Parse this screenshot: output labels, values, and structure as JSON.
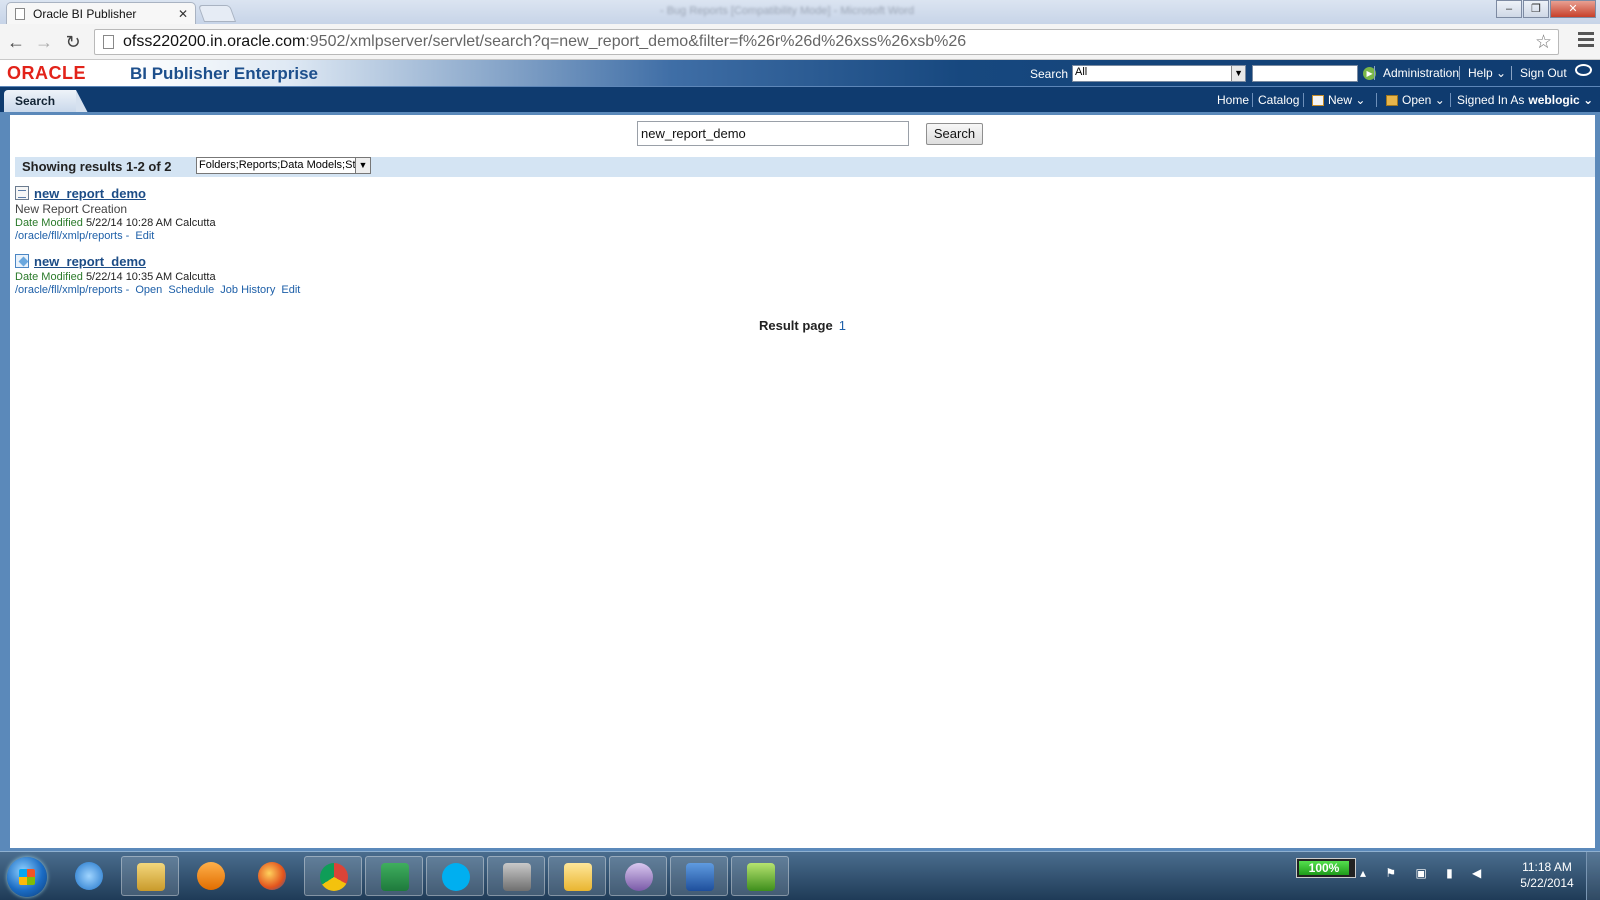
{
  "browser": {
    "tab_title": "Oracle BI Publisher",
    "tab_close": "✕",
    "window_title": "- Bug Reports [Compatibility Mode] - Microsoft Word",
    "url_host": "ofss220200.in.oracle.com",
    "url_path": ":9502/xmlpserver/servlet/search?q=new_report_demo&filter=f%26r%26d%26xss%26xsb%26",
    "window_controls": [
      "–",
      "❐",
      "✕"
    ]
  },
  "header": {
    "logo": "ORACLE",
    "product": "BI Publisher Enterprise",
    "search_label": "Search",
    "search_scope": "All",
    "administration": "Administration",
    "help": "Help ⌄",
    "sign_out": "Sign Out"
  },
  "tabbar": {
    "active_tab": "Search",
    "home": "Home",
    "catalog": "Catalog",
    "new": "New ⌄",
    "open": "Open ⌄",
    "signed_in_as": "Signed In As",
    "username": "weblogic ⌄"
  },
  "search": {
    "query": "new_report_demo",
    "button": "Search",
    "summary": "Showing results 1-2 of 2",
    "filter": "Folders;Reports;Data Models;Style Templates;Sub Templates"
  },
  "results": [
    {
      "title": "new_report_demo",
      "description": "New Report Creation",
      "date_label": "Date Modified",
      "date": "5/22/14 10:28 AM Calcutta",
      "path": "/oracle/fll/xmlp/reports -",
      "actions": [
        "Edit"
      ]
    },
    {
      "title": "new_report_demo",
      "date_label": "Date Modified",
      "date": "5/22/14 10:35 AM Calcutta",
      "path": "/oracle/fll/xmlp/reports -",
      "actions": [
        "Open",
        "Schedule",
        "Job History",
        "Edit"
      ]
    }
  ],
  "pager": {
    "label": "Result page",
    "current": "1"
  },
  "taskbar": {
    "battery": "100%",
    "time": "11:18 AM",
    "date": "5/22/2014",
    "apps": [
      "internet-explorer",
      "file-explorer",
      "media-player",
      "firefox",
      "chrome",
      "excel",
      "skype",
      "sql-developer",
      "outlook",
      "pidgin",
      "word",
      "project"
    ]
  },
  "colors": {
    "oracle_red": "#e2231a",
    "oracle_blue": "#0f3b6f",
    "link_blue": "#1d5fa8",
    "date_green": "#2a7a2a"
  }
}
